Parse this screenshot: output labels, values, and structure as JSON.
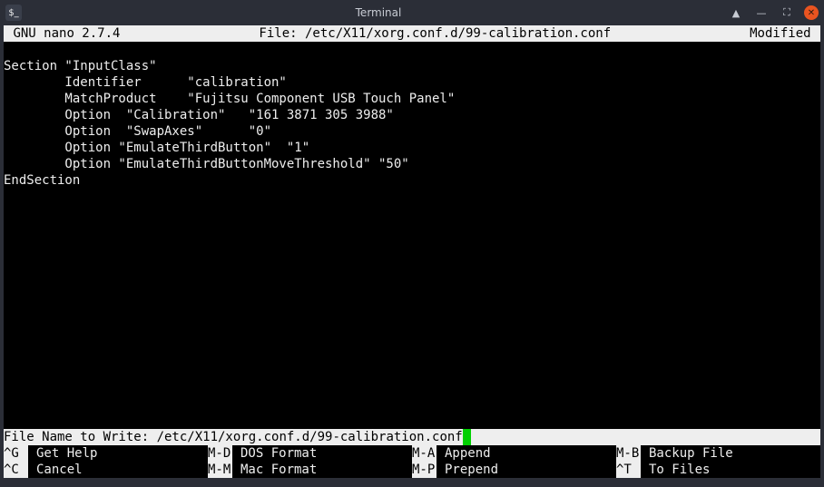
{
  "window": {
    "title": "Terminal",
    "icon_label": "$_"
  },
  "nano": {
    "app": "GNU nano 2.7.4",
    "file_label": "File: /etc/X11/xorg.conf.d/99-calibration.conf",
    "status": "Modified"
  },
  "content_lines": [
    "Section \"InputClass\"",
    "        Identifier      \"calibration\"",
    "        MatchProduct    \"Fujitsu Component USB Touch Panel\"",
    "        Option  \"Calibration\"   \"161 3871 305 3988\"",
    "        Option  \"SwapAxes\"      \"0\"",
    "        Option \"EmulateThirdButton\"  \"1\"",
    "        Option \"EmulateThirdButtonMoveThreshold\" \"50\"",
    "EndSection"
  ],
  "write_prompt": {
    "label": "File Name to Write: ",
    "value": "/etc/X11/xorg.conf.d/99-calibration.conf"
  },
  "shortcuts": [
    {
      "key": "^G",
      "label": "Get Help"
    },
    {
      "key": "M-D",
      "label": "DOS Format"
    },
    {
      "key": "M-A",
      "label": "Append"
    },
    {
      "key": "M-B",
      "label": "Backup File"
    },
    {
      "key": "^C",
      "label": "Cancel"
    },
    {
      "key": "M-M",
      "label": "Mac Format"
    },
    {
      "key": "M-P",
      "label": "Prepend"
    },
    {
      "key": "^T",
      "label": "To Files"
    }
  ]
}
